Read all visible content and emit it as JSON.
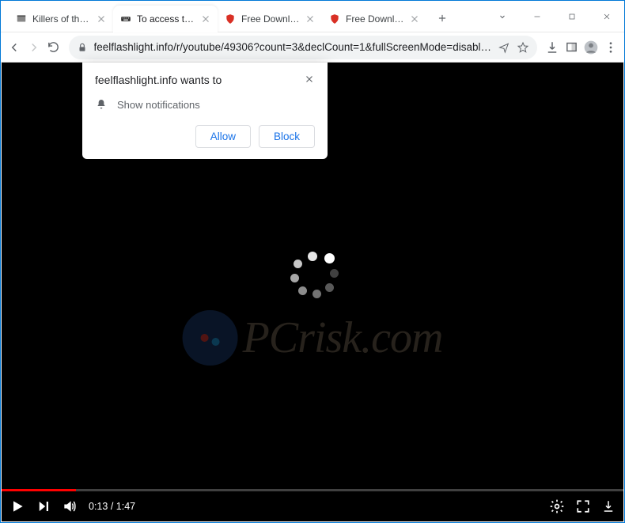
{
  "tabs": [
    {
      "title": "Killers of the Flo",
      "active": false,
      "icon": "movie"
    },
    {
      "title": "To access the w",
      "active": true,
      "icon": "keyboard"
    },
    {
      "title": "Free Download",
      "active": false,
      "icon": "shield"
    },
    {
      "title": "Free Download",
      "active": false,
      "icon": "shield"
    }
  ],
  "url": "feelflashlight.info/r/youtube/49306?count=3&declCount=1&fullScreenMode=disabl…",
  "prompt": {
    "title": "feelflashlight.info wants to",
    "perm": "Show notifications",
    "allow": "Allow",
    "block": "Block"
  },
  "player": {
    "current": "0:13",
    "duration": "1:47"
  },
  "watermark": "PCrisk.com"
}
